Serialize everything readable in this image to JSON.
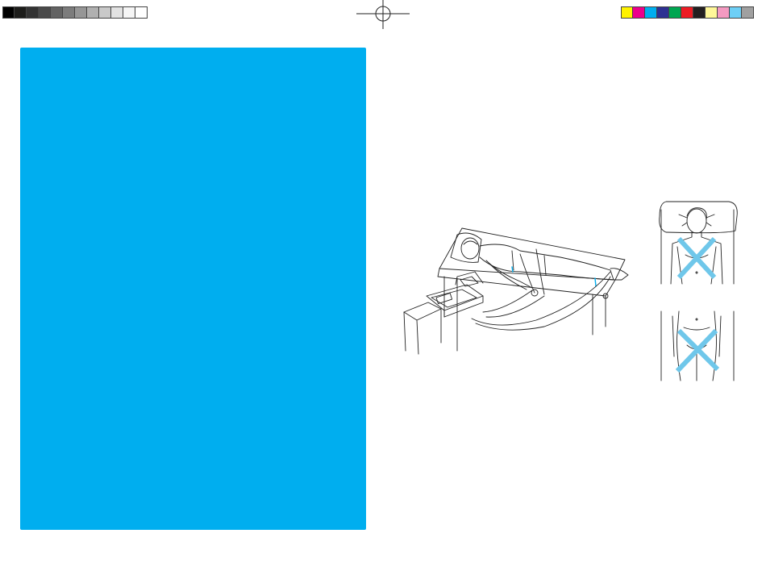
{
  "colors": {
    "panel": "#00aeef",
    "cross": "#6fc7ea",
    "line": "#222222",
    "grayscale": [
      "#000000",
      "#1d1d1b",
      "#333333",
      "#4a4a4a",
      "#636363",
      "#7c7c7c",
      "#969696",
      "#b0b0b0",
      "#c9c9c9",
      "#e2e2e2",
      "#f5f5f5",
      "#ffffff"
    ],
    "process": [
      "#fff200",
      "#ec008c",
      "#00aeef",
      "#2e3192",
      "#00a651",
      "#ed1c24",
      "#231f20",
      "#fff799",
      "#f49ac1",
      "#6dcff6",
      "#a0a0a0"
    ]
  },
  "icons": {
    "registration": "registration-mark-icon",
    "patient": "patient-ecg-setup-illustration",
    "upper": "chest-electrode-placement-illustration",
    "lower": "pelvis-electrode-placement-illustration"
  }
}
